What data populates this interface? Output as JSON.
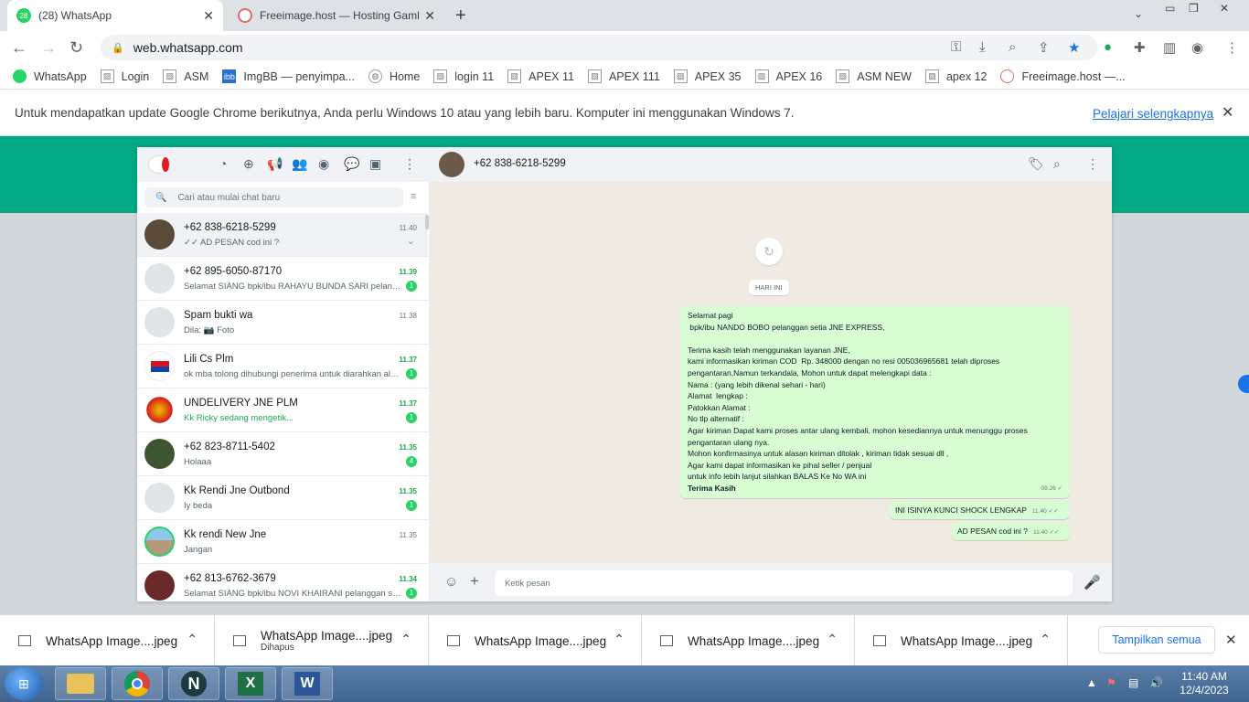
{
  "browser": {
    "tabs": [
      {
        "title": "(28) WhatsApp",
        "favicon_text": "28",
        "favicon_color": "#25d366",
        "active": true
      },
      {
        "title": "Freeimage.host — Hosting Gamb",
        "favicon_text": "",
        "favicon_color": "#e06c6c",
        "active": false
      }
    ],
    "url": "web.whatsapp.com",
    "bookmarks": [
      "WhatsApp",
      "Login",
      "ASM",
      "ImgBB — penyimpa...",
      "Home",
      "login 11",
      "APEX 11",
      "APEX 111",
      "APEX 35",
      "APEX 16",
      "ASM  NEW",
      "apex 12",
      "Freeimage.host —..."
    ],
    "infobar": {
      "message": "Untuk mendapatkan update Google Chrome berikutnya, Anda perlu Windows 10 atau yang lebih baru. Komputer ini menggunakan Windows 7.",
      "link": "Pelajari selengkapnya"
    }
  },
  "whatsapp": {
    "search_placeholder": "Cari atau mulai chat baru",
    "chats": [
      {
        "name": "+62 838-6218-5299",
        "preview": "✓✓ AD PESAN cod  ini ?",
        "time": "11.40",
        "unread": "",
        "selected": true,
        "typing": false
      },
      {
        "name": "+62 895-6050-87170",
        "preview": "Selamat SIANG  bpk/ibu RAHAYU BUNDA SARI pelanggan setia JNE EXPRESS,",
        "time": "11.39",
        "unread": "1",
        "selected": false,
        "typing": false
      },
      {
        "name": "Spam bukti wa",
        "preview": "Dila: 📷 Foto",
        "time": "11.38",
        "unread": "",
        "selected": false,
        "typing": false
      },
      {
        "name": "Lili Cs Plm",
        "preview": "ok mba tolong dihubungi penerima untuk diarahkan alamat",
        "time": "11.37",
        "unread": "1",
        "selected": false,
        "typing": false
      },
      {
        "name": "UNDELIVERY JNE PLM",
        "preview": "Kk Ricky sedang mengetik...",
        "time": "11.37",
        "unread": "1",
        "selected": false,
        "typing": true
      },
      {
        "name": "+62 823-8711-5402",
        "preview": "Holaaa",
        "time": "11.35",
        "unread": "4",
        "selected": false,
        "typing": false
      },
      {
        "name": "Kk Rendi Jne Outbond",
        "preview": "Iy beda",
        "time": "11.35",
        "unread": "1",
        "selected": false,
        "typing": false
      },
      {
        "name": "Kk rendi New Jne",
        "preview": "Jangan",
        "time": "11.35",
        "unread": "",
        "selected": false,
        "typing": false
      },
      {
        "name": "+62 813-6762-3679",
        "preview": "Selamat SIANG  bpk/ibu NOVI KHAIRANI pelanggan setia JNE EXPRESS,",
        "time": "11.34",
        "unread": "1",
        "selected": false,
        "typing": false
      }
    ],
    "conversation": {
      "contact": "+62 838-6218-5299",
      "day_label": "HARI INI",
      "message1_lines": [
        "Selamat pagi",
        " bpk/ibu NANDO BOBO pelanggan setia JNE EXPRESS,",
        "",
        "Terima kasih telah menggunakan layanan JNE,",
        "kami informasikan kiriman COD  Rp. 348000 dengan no resi 005036965681 telah diproses",
        "pengantaran,Namun terkandala, Mohon untuk dapat melengkapi data :",
        "Nama : (yang lebih dikenal sehari - hari)",
        "Alamat  lengkap :",
        "Patokkan Alamat :",
        "No tlp alternatif :",
        "Agar kiriman Dapat kami proses antar ulang kembali, mohon kesediannya untuk menunggu proses",
        "pengantaran ulang nya.",
        "Mohon konfirmasinya untuk alasan kiriman ditolak , kiriman tidak sesuai dll ,",
        "Agar kami dapat informasikan ke pihal seller / penjual",
        "untuk info lebih lanjut silahkan BALAS Ke No WA ini",
        "Terima Kasih"
      ],
      "message1_time": "09.26 ✓",
      "message2": "INI ISINYA  KUNCI SHOCK LENGKAP",
      "message2_time": "11.40 ✓✓",
      "message3": "AD PESAN cod  ini ?",
      "message3_time": "11.40 ✓✓",
      "input_placeholder": "Ketik pesan"
    }
  },
  "downloads": {
    "items": [
      {
        "name": "WhatsApp Image....jpeg",
        "sub": ""
      },
      {
        "name": "WhatsApp Image....jpeg",
        "sub": "Dihapus"
      },
      {
        "name": "WhatsApp Image....jpeg",
        "sub": ""
      },
      {
        "name": "WhatsApp Image....jpeg",
        "sub": ""
      },
      {
        "name": "WhatsApp Image....jpeg",
        "sub": ""
      }
    ],
    "show_all": "Tampilkan semua"
  },
  "taskbar": {
    "time": "11:40 AM",
    "date": "12/4/2023"
  },
  "colors": {
    "whatsapp_green": "#00a884",
    "unread_badge": "#25d366",
    "outgoing_bubble": "#d9fdd3"
  }
}
